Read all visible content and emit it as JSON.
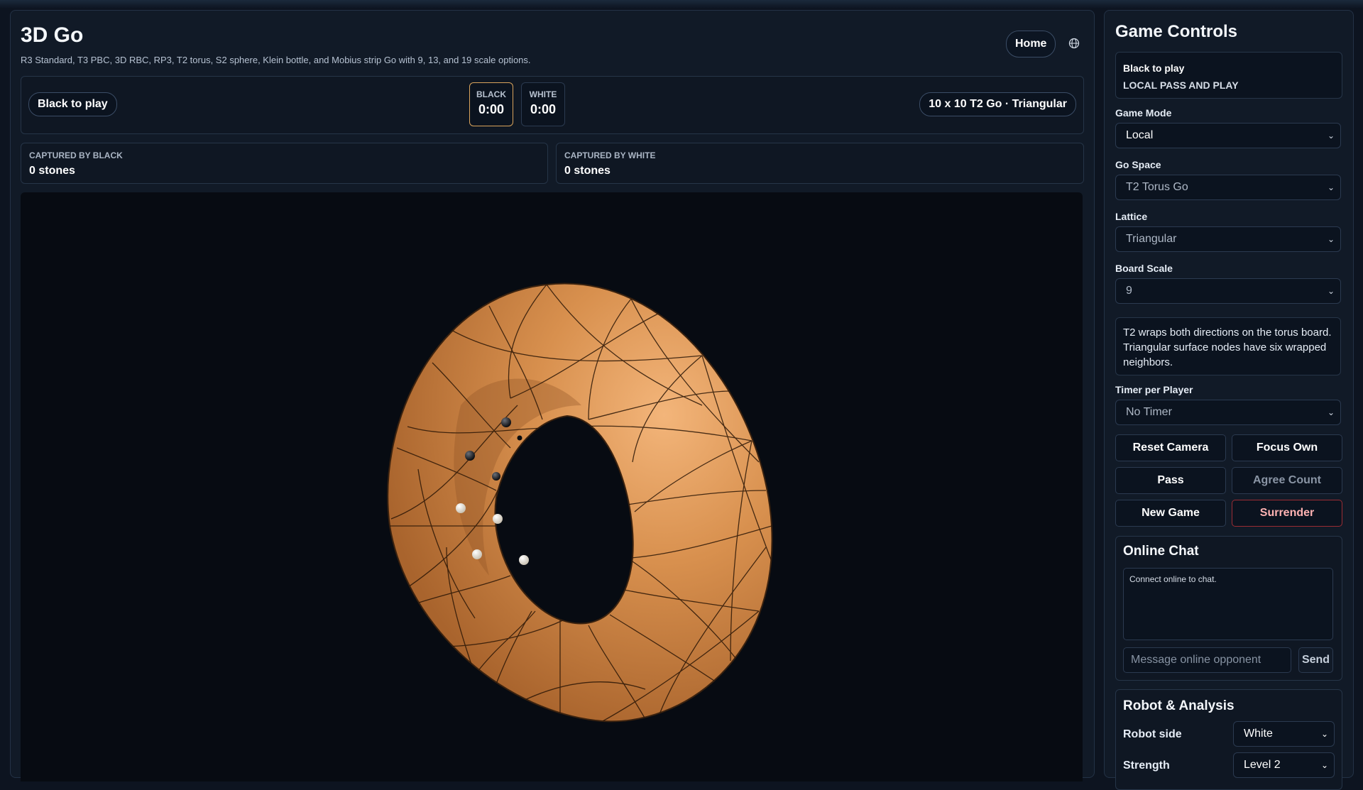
{
  "app": {
    "title": "3D Go",
    "subtitle": "R3 Standard, T3 PBC, 3D RBC, RP3, T2 torus, S2 sphere, Klein bottle, and Mobius strip Go with 9, 13, and 19 scale options.",
    "home_label": "Home",
    "globe_icon": "globe-icon"
  },
  "status": {
    "turn": "Black to play",
    "black_label": "BLACK",
    "black_time": "0:00",
    "white_label": "WHITE",
    "white_time": "0:00",
    "board_label": "10 x 10 T2 Go · Triangular"
  },
  "captures": {
    "black_label": "CAPTURED BY BLACK",
    "black_value": "0 stones",
    "white_label": "CAPTURED BY WHITE",
    "white_value": "0 stones"
  },
  "board": {
    "surface_color": "#d8904e",
    "black_stones": 4,
    "white_stones": 5
  },
  "controls": {
    "title": "Game Controls",
    "status_line1": "Black to play",
    "status_line2": "LOCAL PASS AND PLAY",
    "game_mode_label": "Game Mode",
    "game_mode_value": "Local",
    "go_space_label": "Go Space",
    "go_space_value": "T2 Torus Go",
    "lattice_label": "Lattice",
    "lattice_value": "Triangular",
    "board_scale_label": "Board Scale",
    "board_scale_value": "9",
    "note": "T2 wraps both directions on the torus board. Triangular surface nodes have six wrapped neighbors.",
    "timer_label": "Timer per Player",
    "timer_value": "No Timer",
    "reset_camera": "Reset Camera",
    "focus_own": "Focus Own",
    "pass": "Pass",
    "agree_count": "Agree Count",
    "new_game": "New Game",
    "surrender": "Surrender"
  },
  "chat": {
    "title": "Online Chat",
    "log_text": "Connect online to chat.",
    "input_placeholder": "Message online opponent",
    "send_label": "Send"
  },
  "robot": {
    "title": "Robot & Analysis",
    "side_label": "Robot side",
    "side_value": "White",
    "strength_label": "Strength",
    "strength_value": "Level 2"
  }
}
